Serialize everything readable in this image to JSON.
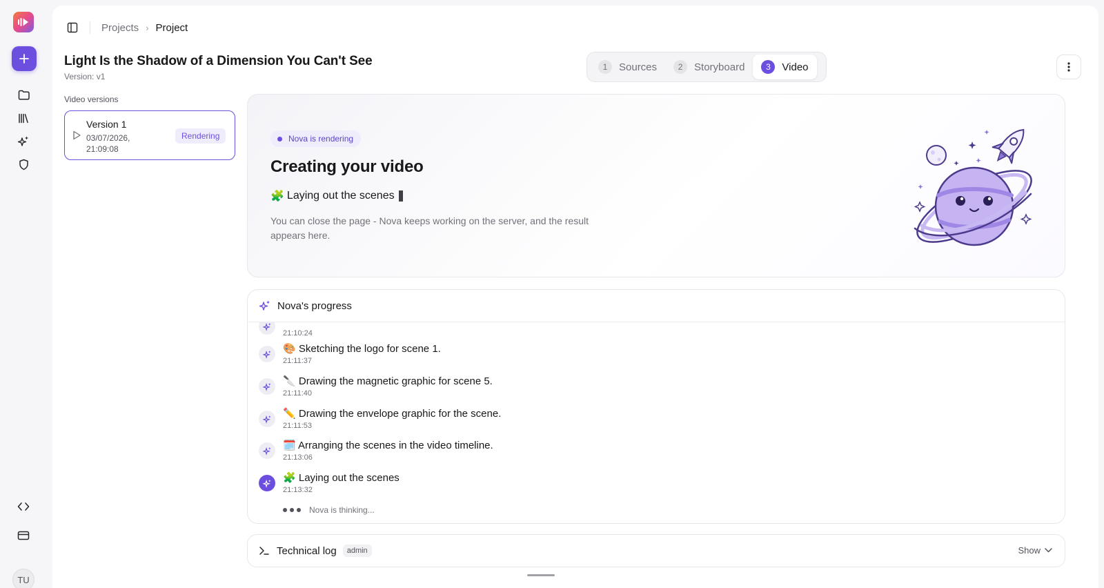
{
  "breadcrumb": {
    "parent": "Projects",
    "current": "Project"
  },
  "project": {
    "title": "Light Is the Shadow of a Dimension You Can't See",
    "version": "Version: v1"
  },
  "stepper": [
    {
      "num": "1",
      "label": "Sources",
      "active": false
    },
    {
      "num": "2",
      "label": "Storyboard",
      "active": false
    },
    {
      "num": "3",
      "label": "Video",
      "active": true
    }
  ],
  "versions": {
    "label": "Video versions",
    "items": [
      {
        "name": "Version 1",
        "date": "03/07/2026, 21:09:08",
        "badge": "Rendering"
      }
    ]
  },
  "hero": {
    "pill": "Nova is rendering",
    "title": "Creating your video",
    "status_emoji": "🧩",
    "status": "Laying out the scenes",
    "note": "You can close the page - Nova keeps working on the server, and the result appears here."
  },
  "progress": {
    "title": "Nova's progress",
    "entries": [
      {
        "emoji": "",
        "text": "",
        "time": "21:10:24"
      },
      {
        "emoji": "🎨",
        "text": "Sketching the logo for scene 1.",
        "time": "21:11:37"
      },
      {
        "emoji": "🔪",
        "text": "Drawing the magnetic graphic for scene 5.",
        "time": "21:11:40"
      },
      {
        "emoji": "✏️",
        "text": "Drawing the envelope graphic for the scene.",
        "time": "21:11:53"
      },
      {
        "emoji": "🗓️",
        "text": "Arranging the scenes in the video timeline.",
        "time": "21:13:06"
      },
      {
        "emoji": "🧩",
        "text": "Laying out the scenes",
        "time": "21:13:32"
      }
    ],
    "thinking": "Nova is thinking..."
  },
  "techlog": {
    "label": "Technical log",
    "badge": "admin",
    "toggle": "Show"
  },
  "user": {
    "initials": "TU"
  },
  "colors": {
    "accent": "#6d4fe0",
    "accent_soft": "#efecfb"
  }
}
